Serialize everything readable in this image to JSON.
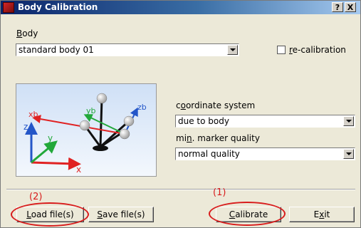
{
  "window": {
    "title": "Body Calibration",
    "help_button": "?",
    "close_button": "X"
  },
  "body_label": {
    "prefix": "",
    "accel": "B",
    "rest": "ody"
  },
  "body_select": {
    "value": "standard body 01"
  },
  "recalibration": {
    "checked": false,
    "accel": "r",
    "rest": "e-calibration"
  },
  "illustration": {
    "axis_labels": {
      "xb": "xb",
      "yb": "yb",
      "zb": "zb",
      "x": "x",
      "y": "y",
      "z": "z"
    }
  },
  "coordinate_system": {
    "label_prefix": "c",
    "accel": "o",
    "label_rest": "ordinate system",
    "value": "due to body"
  },
  "marker_quality": {
    "label_prefix": "mi",
    "accel": "n",
    "label_rest": ". marker quality",
    "value": "normal quality"
  },
  "buttons": {
    "load": {
      "accel": "L",
      "rest": "oad file(s)"
    },
    "save": {
      "accel": "S",
      "rest": "ave file(s)"
    },
    "calibrate": {
      "accel": "C",
      "rest": "alibrate"
    },
    "exit": {
      "prefix": "E",
      "accel": "x",
      "rest": "it"
    }
  },
  "annotations": {
    "load": "(2)",
    "calibrate": "(1)"
  },
  "colors": {
    "annotation": "#d81c1c",
    "titlebar_start": "#0a246a",
    "titlebar_end": "#a6caf0"
  }
}
